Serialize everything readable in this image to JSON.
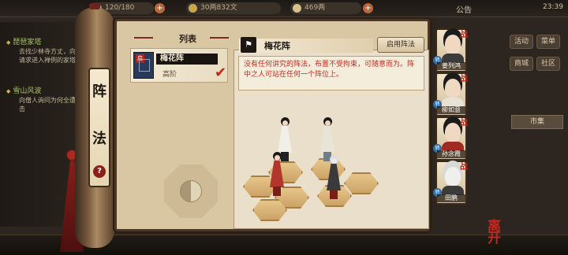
{
  "topbar": {
    "stamina": "120/180",
    "coins": "30两832文",
    "ingots": "469两",
    "announcement": "公告",
    "time": "23:39",
    "plus": "+"
  },
  "quests": [
    {
      "title": "琵琶家塔",
      "desc": "去找少林寺方丈，向其请求进入禅例的家塔"
    },
    {
      "title": "雪山风波",
      "desc": "向僧人询问为何全遭袭击"
    }
  ],
  "right_menu": {
    "buttons": [
      "活动",
      "菜单",
      "商城",
      "社区"
    ],
    "market_tab": "市集",
    "market_label": "市"
  },
  "scroll": {
    "title_chars": [
      "阵",
      "法"
    ],
    "help": "?"
  },
  "list": {
    "header": "列表",
    "items": [
      {
        "badge": "启",
        "name": "梅花阵",
        "grade": "高阶",
        "selected": true
      }
    ]
  },
  "formation": {
    "name": "梅花阵",
    "enable_label": "启用阵法",
    "description": "没有任何讲究的阵法，布置不受拘束，可随意而为。阵中之人可站在任何一个阵位上。"
  },
  "team": [
    {
      "name": "姜列鸿",
      "tag": "转",
      "mark": "战"
    },
    {
      "name": "柳如意",
      "tag": "转",
      "mark": "战"
    },
    {
      "name": "孙念霞",
      "tag": "转",
      "mark": "战"
    },
    {
      "name": "田鹏",
      "tag": "转",
      "mark": "战"
    }
  ],
  "leave_button": "离开",
  "colors": {
    "accent_red": "#c6231b",
    "parchment": "#d9c7a3",
    "tile": "#e9c88c"
  }
}
